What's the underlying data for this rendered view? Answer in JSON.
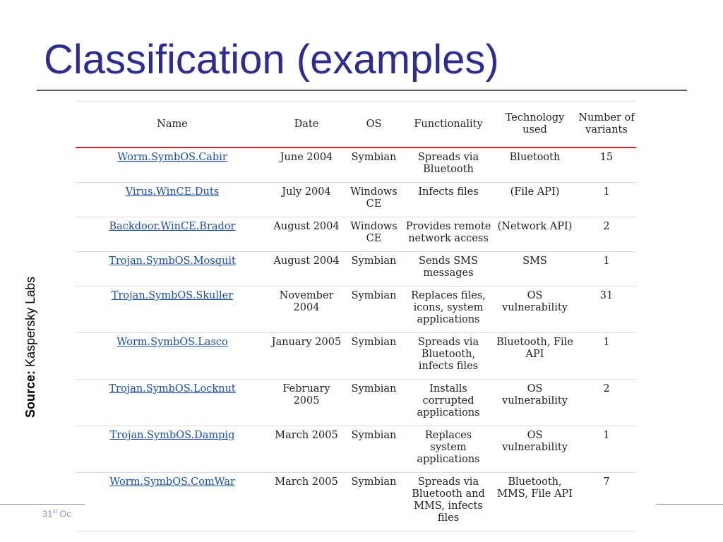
{
  "slide": {
    "title": "Classification (examples)",
    "source_label": "Source:",
    "source_value": "Kaspersky Labs",
    "footer_prefix": "31",
    "footer_sup": "st",
    "footer_suffix": " Oc"
  },
  "table": {
    "headers": {
      "name": "Name",
      "date": "Date",
      "os": "OS",
      "functionality": "Functionality",
      "technology": "Technology used",
      "variants": "Number of variants"
    },
    "rows": [
      {
        "name": "Worm.SymbOS.Cabir",
        "date": "June 2004",
        "os": "Symbian",
        "functionality": "Spreads via Bluetooth",
        "technology": "Bluetooth",
        "variants": "15"
      },
      {
        "name": "Virus.WinCE.Duts",
        "date": "July 2004",
        "os": "Windows CE",
        "functionality": "Infects files",
        "technology": "(File API)",
        "variants": "1"
      },
      {
        "name": "Backdoor.WinCE.Brador",
        "date": "August 2004",
        "os": "Windows CE",
        "functionality": "Provides remote network access",
        "technology": "(Network API)",
        "variants": "2"
      },
      {
        "name": "Trojan.SymbOS.Mosquit",
        "date": "August 2004",
        "os": "Symbian",
        "functionality": "Sends SMS messages",
        "technology": "SMS",
        "variants": "1"
      },
      {
        "name": "Trojan.SymbOS.Skuller",
        "date": "November 2004",
        "os": "Symbian",
        "functionality": "Replaces files, icons, system applications",
        "technology": "OS vulnerability",
        "variants": "31"
      },
      {
        "name": "Worm.SymbOS.Lasco",
        "date": "January 2005",
        "os": "Symbian",
        "functionality": "Spreads via Bluetooth, infects files",
        "technology": "Bluetooth, File API",
        "variants": "1"
      },
      {
        "name": "Trojan.SymbOS.Locknut",
        "date": "February 2005",
        "os": "Symbian",
        "functionality": "Installs corrupted applications",
        "technology": "OS vulnerability",
        "variants": "2"
      },
      {
        "name": "Trojan.SymbOS.Dampig",
        "date": "March 2005",
        "os": "Symbian",
        "functionality": "Replaces system applications",
        "technology": "OS vulnerability",
        "variants": "1"
      },
      {
        "name": "Worm.SymbOS.ComWar",
        "date": "March 2005",
        "os": "Symbian",
        "functionality": "Spreads via Bluetooth and MMS, infects files",
        "technology": "Bluetooth, MMS, File API",
        "variants": "7"
      }
    ]
  }
}
